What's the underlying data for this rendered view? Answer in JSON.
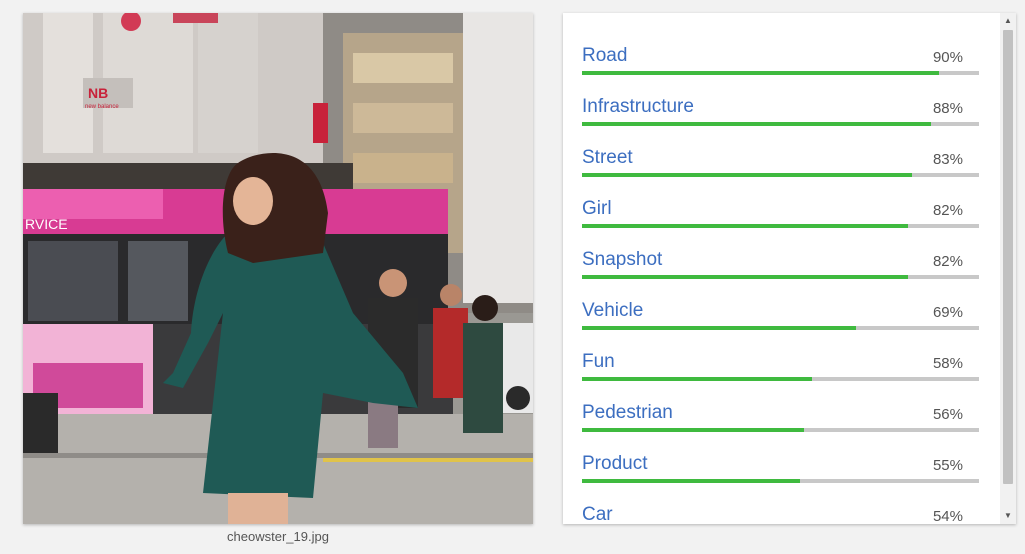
{
  "photo": {
    "filename": "cheowster_19.jpg",
    "bus_sign_text": "RVICE",
    "brand_text": "new balance"
  },
  "labels": [
    {
      "name": "Road",
      "score_text": "90%",
      "score": 0.9
    },
    {
      "name": "Infrastructure",
      "score_text": "88%",
      "score": 0.88
    },
    {
      "name": "Street",
      "score_text": "83%",
      "score": 0.83
    },
    {
      "name": "Girl",
      "score_text": "82%",
      "score": 0.82
    },
    {
      "name": "Snapshot",
      "score_text": "82%",
      "score": 0.82
    },
    {
      "name": "Vehicle",
      "score_text": "69%",
      "score": 0.69
    },
    {
      "name": "Fun",
      "score_text": "58%",
      "score": 0.58
    },
    {
      "name": "Pedestrian",
      "score_text": "56%",
      "score": 0.56
    },
    {
      "name": "Product",
      "score_text": "55%",
      "score": 0.55
    },
    {
      "name": "Car",
      "score_text": "54%",
      "score": 0.54
    }
  ],
  "colors": {
    "label_text": "#3c6ec0",
    "bar_fill": "#3fba3f",
    "bar_track": "#c8c8c8"
  },
  "scrollbar": {
    "up_icon": "triangle-up-icon",
    "down_icon": "triangle-down-icon"
  }
}
